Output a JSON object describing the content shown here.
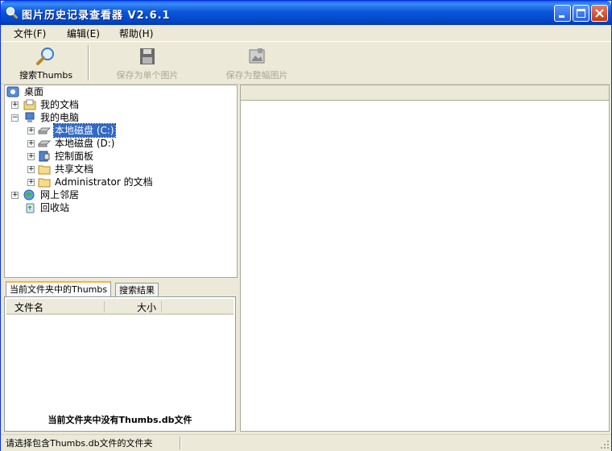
{
  "window": {
    "title": "图片历史记录查看器 V2.6.1",
    "controls": [
      "minimize",
      "maximize",
      "close"
    ]
  },
  "menu": [
    "文件(F)",
    "编辑(E)",
    "帮助(H)"
  ],
  "toolbar": {
    "search_label": "搜索Thumbs",
    "save_single_label": "保存为单个图片",
    "save_whole_label": "保存为整幅图片"
  },
  "tree": {
    "desktop": "桌面",
    "my_documents": "我的文档",
    "my_computer": "我的电脑",
    "drive_c": "本地磁盘 (C:)",
    "drive_d": "本地磁盘 (D:)",
    "control_panel": "控制面板",
    "shared_docs": "共享文档",
    "admin_docs": "Administrator 的文档",
    "network": "网上邻居",
    "recycle_bin": "回收站"
  },
  "tabs": {
    "current": "当前文件夹中的Thumbs",
    "results": "搜索结果"
  },
  "list": {
    "col_name": "文件名",
    "col_size": "大小",
    "empty_message": "当前文件夹中没有Thumbs.db文件"
  },
  "status": {
    "text": "请选择包含Thumbs.db文件的文件夹"
  },
  "colors": {
    "titlebar": "#0b56db",
    "selection": "#316ac5",
    "tab_accent": "#f9b34c",
    "face": "#ece9d8"
  }
}
